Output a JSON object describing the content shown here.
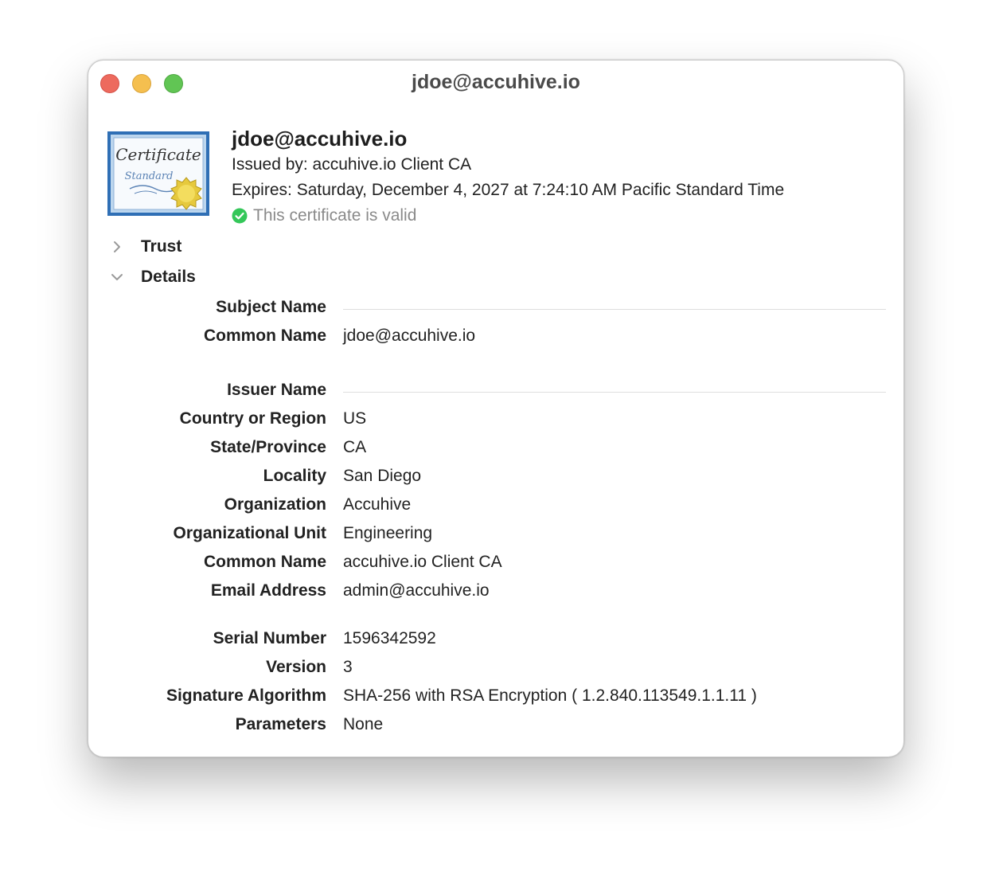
{
  "window": {
    "title": "jdoe@accuhive.io"
  },
  "header": {
    "name": "jdoe@accuhive.io",
    "issued_by": "Issued by: accuhive.io Client CA",
    "expires": "Expires: Saturday, December 4, 2027 at 7:24:10 AM Pacific Standard Time",
    "status": "This certificate is valid",
    "icon": "certificate-standard-icon",
    "icon_text_top": "Certificate",
    "icon_text_bottom": "Standard"
  },
  "sections": {
    "trust_label": "Trust",
    "details_label": "Details"
  },
  "details": {
    "subject_name": "Subject Name",
    "subject_common_name_label": "Common Name",
    "subject_common_name": "jdoe@accuhive.io",
    "issuer_name": "Issuer Name",
    "country_label": "Country or Region",
    "country": "US",
    "state_label": "State/Province",
    "state": "CA",
    "locality_label": "Locality",
    "locality": "San Diego",
    "organization_label": "Organization",
    "organization": "Accuhive",
    "org_unit_label": "Organizational Unit",
    "org_unit": "Engineering",
    "issuer_common_name_label": "Common Name",
    "issuer_common_name": "accuhive.io Client CA",
    "email_label": "Email Address",
    "email": "admin@accuhive.io",
    "serial_label": "Serial Number",
    "serial": "1596342592",
    "version_label": "Version",
    "version": "3",
    "sig_alg_label": "Signature Algorithm",
    "sig_alg": "SHA-256 with RSA Encryption ( 1.2.840.113549.1.1.11 )",
    "params_label": "Parameters",
    "params": "None"
  },
  "colors": {
    "close": "#ed6a5e",
    "minimize": "#f5bf4f",
    "zoom": "#61c554",
    "valid_green": "#34c759"
  }
}
